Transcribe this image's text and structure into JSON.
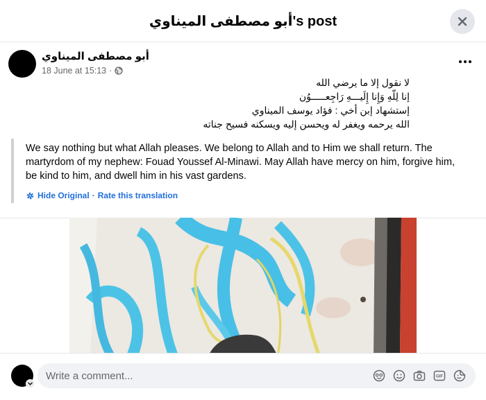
{
  "header": {
    "title": "أبو مصطفى الميناوي's post"
  },
  "post": {
    "author": "أبو مصطفى الميناوي",
    "date": "18 June at 15:13",
    "separator": "·",
    "privacy_icon": "globe-icon",
    "more_icon": "more-dots-icon",
    "body_lines": [
      "لا نقول إلا ما يرضي الله",
      "إنا لِلّهِ وَإِنا إِلَيـــهِ رَاجِعـــــوُن",
      "إستشهاد إبن أخي : فؤاد يوسف الميناوي",
      "الله  يرحمه ويغفر له ويحسن إليه ويسكنه فسيح جناته"
    ],
    "translation": {
      "text": "We say nothing but what Allah pleases. We belong to Allah and to Him we shall return. The martyrdom of my nephew: Fouad Youssef Al-Minawi. May Allah have mercy on him, forgive him, be kind to him, and dwell him in his vast gardens.",
      "hide_original": "Hide Original",
      "link_separator": "·",
      "rate": "Rate this translation",
      "settings_icon": "gear-icon"
    }
  },
  "comment": {
    "placeholder": "Write a comment...",
    "icons": [
      "avatar-sticker-icon",
      "emoji-icon",
      "camera-icon",
      "gif-icon",
      "sticker-icon"
    ]
  },
  "colors": {
    "link": "#216fdb",
    "secondary_text": "#65676b",
    "divider": "#e4e6eb",
    "input_bg": "#f0f2f5"
  }
}
